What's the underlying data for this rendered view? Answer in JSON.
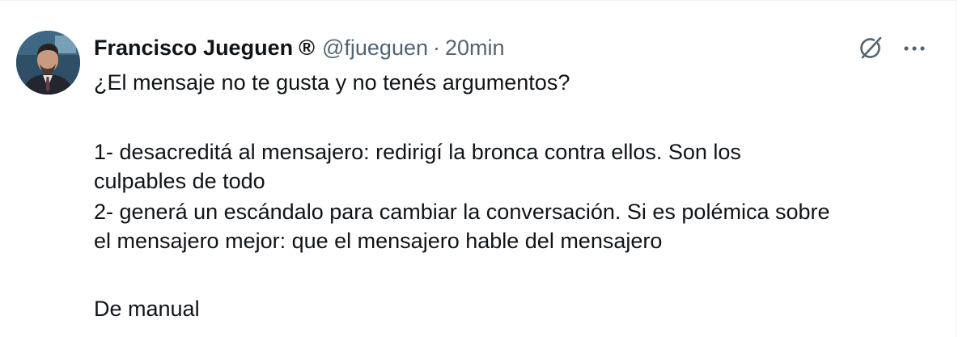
{
  "author": {
    "name": "Francisco Jueguen",
    "badge": "®",
    "handle": "@fjueguen",
    "separator": "·",
    "time": "20min"
  },
  "tweet": {
    "line1": "¿El mensaje no te gusta y no tenés argumentos?",
    "line2": "1- desacreditá al mensajero: redirigí la bronca contra ellos. Son los",
    "line3": "culpables de todo",
    "line4": "2- generá un escándalo para cambiar la conversación. Si es polémica sobre",
    "line5": "el mensajero mejor: que el mensajero hable del mensajero",
    "line6": "De manual"
  },
  "icons": {
    "grok": "grok-icon",
    "more": "more-icon",
    "avatar": "avatar"
  },
  "colors": {
    "text": "#0f1419",
    "secondary": "#536471",
    "border": "#eff3f4"
  }
}
